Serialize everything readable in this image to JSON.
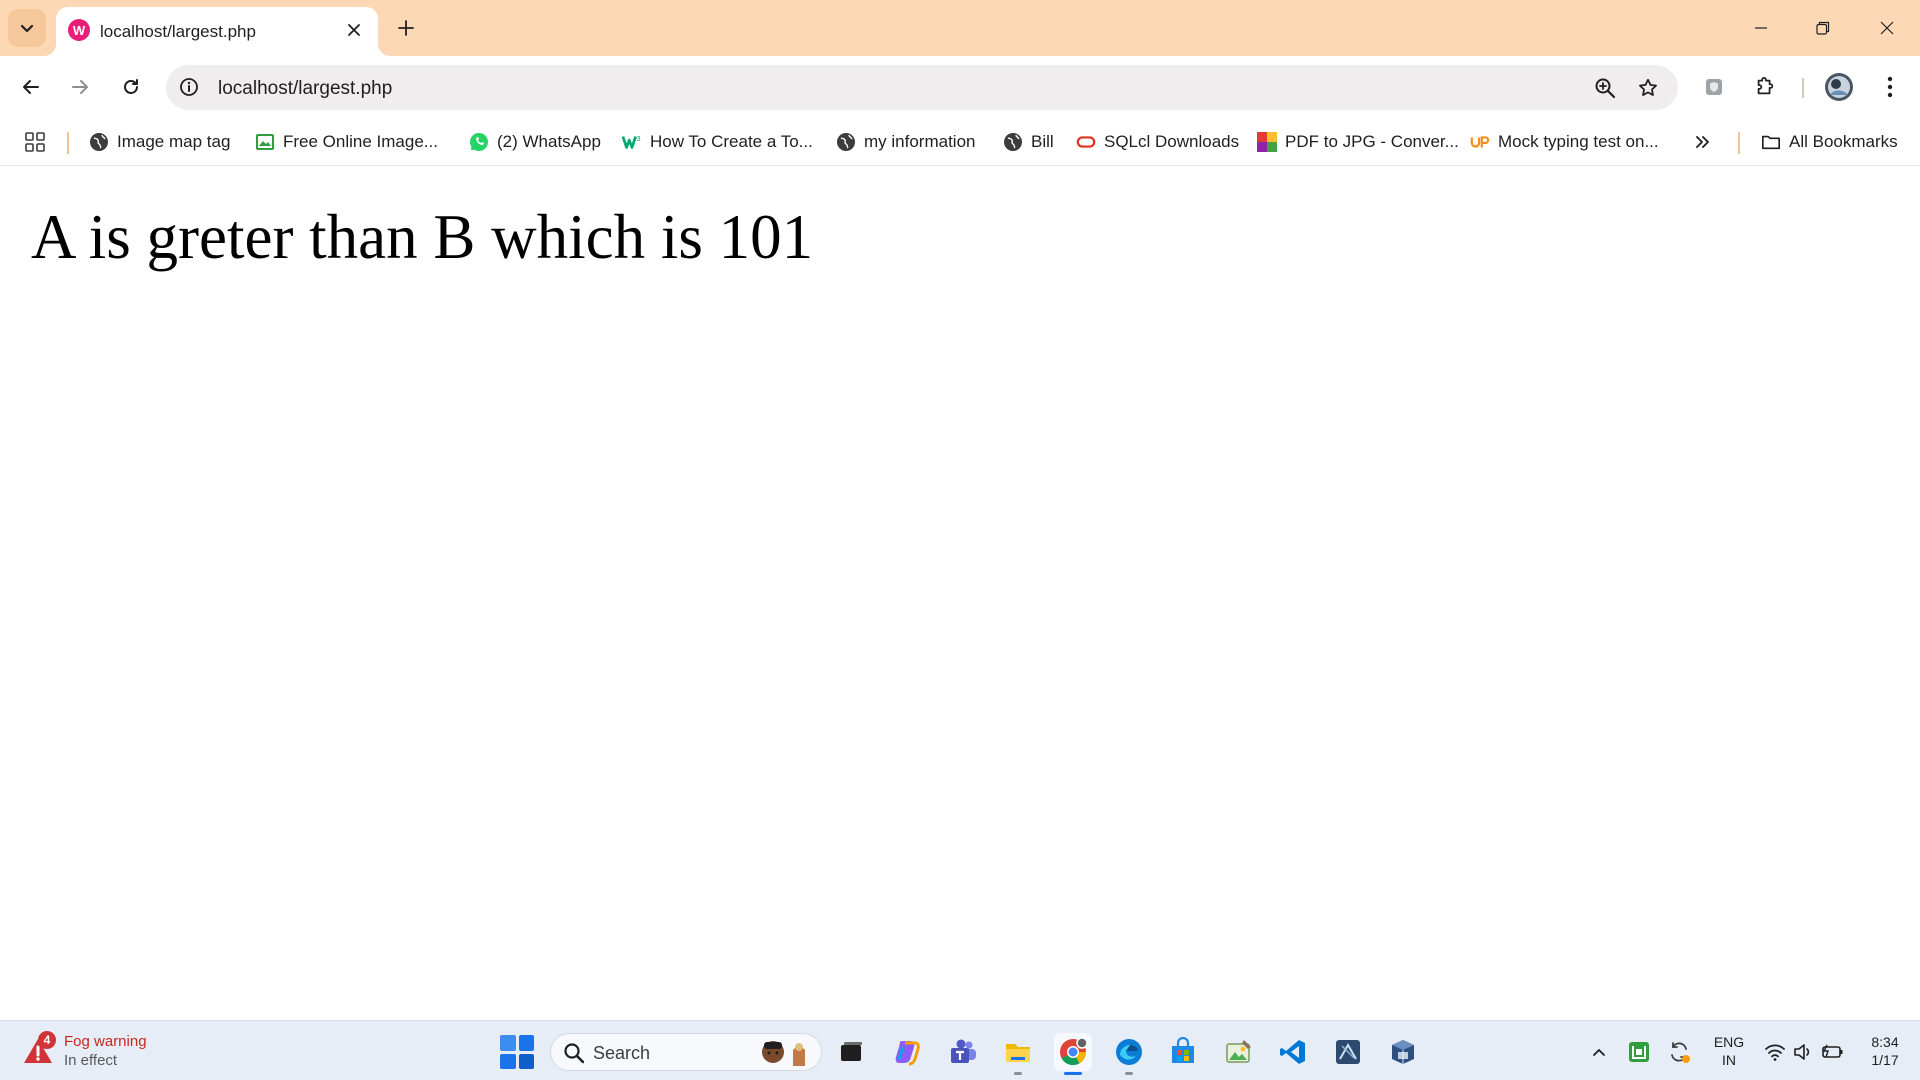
{
  "browser": {
    "tab": {
      "title": "localhost/largest.php"
    },
    "address_bar": {
      "url": "localhost/largest.php"
    },
    "bookmarks": [
      {
        "label": "Image map tag",
        "icon": "globe-icon"
      },
      {
        "label": "Free Online Image...",
        "icon": "image-icon"
      },
      {
        "label": "(2) WhatsApp",
        "icon": "whatsapp-icon"
      },
      {
        "label": "How To Create a To...",
        "icon": "w3-icon"
      },
      {
        "label": "my information",
        "icon": "globe-icon"
      },
      {
        "label": "Bill",
        "icon": "globe-icon"
      },
      {
        "label": "SQLcl Downloads",
        "icon": "oracle-icon"
      },
      {
        "label": "PDF to JPG - Conver...",
        "icon": "pdf-tool-icon"
      },
      {
        "label": "Mock typing test on...",
        "icon": "up-logo-icon"
      }
    ],
    "all_bookmarks_label": "All Bookmarks",
    "frame_color": "#fdd8b5"
  },
  "page": {
    "heading": "A is greter than B which is 101"
  },
  "taskbar": {
    "weather": {
      "title": "Fog warning",
      "subtitle": "In effect",
      "badge": "4"
    },
    "search_label": "Search",
    "language": {
      "line1": "ENG",
      "line2": "IN"
    },
    "clock": {
      "time": "8:34",
      "date": "1/17"
    },
    "accent_color": "#1a73e8"
  }
}
